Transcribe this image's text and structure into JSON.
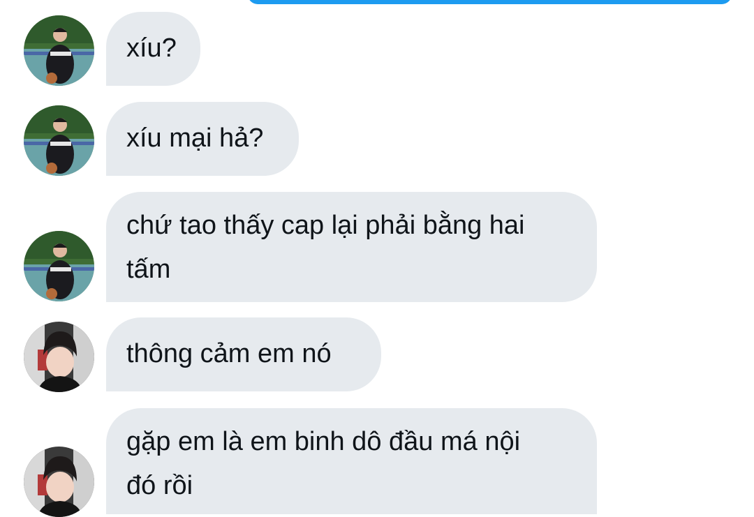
{
  "conversation": {
    "messages": [
      {
        "sender_avatar": "avatar-sports-court",
        "text": "xíu?"
      },
      {
        "sender_avatar": "avatar-sports-court",
        "text": "xíu mại hả?"
      },
      {
        "sender_avatar": "avatar-sports-court",
        "text": "chứ tao thấy cap lại phải bằng hai\ntấm"
      },
      {
        "sender_avatar": "avatar-selfie-boy",
        "text": "thông cảm em nó"
      },
      {
        "sender_avatar": "avatar-selfie-boy",
        "text": "gặp em là em binh dô đầu má nội\nđó rồi"
      }
    ]
  },
  "colors": {
    "incoming_bubble": "#e6eaee",
    "outgoing_bubble": "#1d9bf0",
    "text": "#0f1419"
  }
}
